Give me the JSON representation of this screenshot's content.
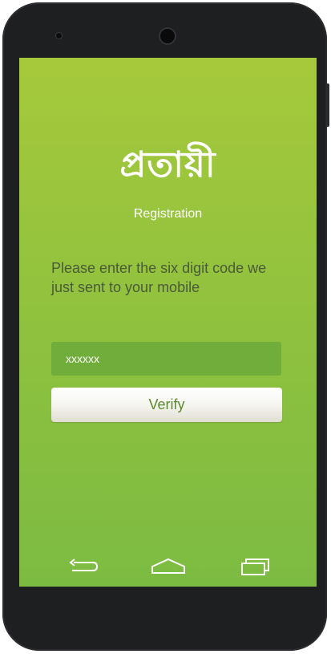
{
  "app": {
    "brand": "প্রতায়ী",
    "subtitle": "Registration"
  },
  "verification": {
    "instruction": "Please enter the six digit code we just sent to your mobile",
    "code_placeholder": "xxxxxx",
    "code_value": "",
    "verify_label": "Verify"
  },
  "navigation": {
    "back_icon": "back-arrow-icon",
    "home_icon": "home-icon",
    "recents_icon": "recent-apps-icon"
  },
  "colors": {
    "screen_top": "#a6c93b",
    "screen_bottom": "#7cbb42",
    "input_background": "#70ad3a",
    "verify_text": "#5c8a2c",
    "device_body": "#1e1f21"
  }
}
